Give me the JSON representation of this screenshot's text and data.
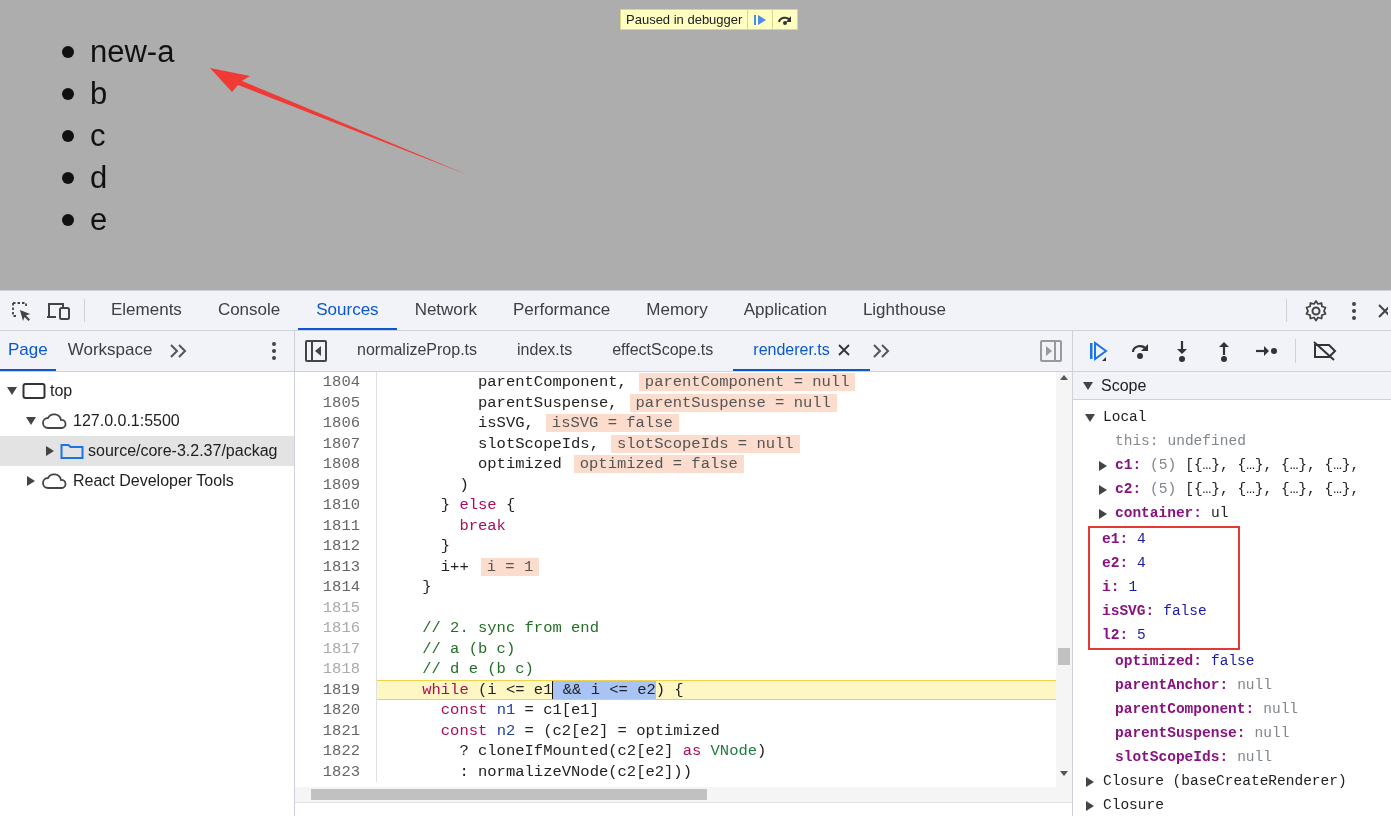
{
  "page": {
    "items": [
      "new-a",
      "b",
      "c",
      "d",
      "e"
    ],
    "paused_banner": {
      "text": "Paused in debugger"
    }
  },
  "devtools": {
    "tabs": [
      {
        "label": "Elements",
        "selected": false
      },
      {
        "label": "Console",
        "selected": false
      },
      {
        "label": "Sources",
        "selected": true
      },
      {
        "label": "Network",
        "selected": false
      },
      {
        "label": "Performance",
        "selected": false
      },
      {
        "label": "Memory",
        "selected": false
      },
      {
        "label": "Application",
        "selected": false
      },
      {
        "label": "Lighthouse",
        "selected": false
      }
    ],
    "navigator": {
      "tabs": [
        {
          "label": "Page",
          "selected": true
        },
        {
          "label": "Workspace",
          "selected": false
        }
      ],
      "tree": [
        {
          "label": "top",
          "kind": "frame",
          "expanded": true,
          "selected": false,
          "children": [
            {
              "label": "127.0.0.1:5500",
              "kind": "cloud",
              "expanded": true,
              "selected": false,
              "children": [
                {
                  "label": "source/core-3.2.37/packag",
                  "kind": "folder",
                  "expanded": false,
                  "selected": true
                }
              ]
            },
            {
              "label": "React Developer Tools",
              "kind": "cloud",
              "expanded": false,
              "selected": false
            }
          ]
        }
      ]
    },
    "editor": {
      "tabs": [
        {
          "label": "normalizeProp.ts",
          "selected": false
        },
        {
          "label": "index.ts",
          "selected": false
        },
        {
          "label": "effectScope.ts",
          "selected": false
        },
        {
          "label": "renderer.ts",
          "selected": true
        }
      ],
      "lines": [
        {
          "number": "1804",
          "muted": false,
          "execution": false,
          "tokens": [
            {
              "text": "          parentComponent,",
              "kind": "plain"
            },
            {
              "text": "parentComponent = null",
              "kind": "value"
            }
          ]
        },
        {
          "number": "1805",
          "muted": false,
          "execution": false,
          "tokens": [
            {
              "text": "          parentSuspense,",
              "kind": "plain"
            },
            {
              "text": "parentSuspense = null",
              "kind": "value"
            }
          ]
        },
        {
          "number": "1806",
          "muted": false,
          "execution": false,
          "tokens": [
            {
              "text": "          isSVG,",
              "kind": "plain"
            },
            {
              "text": "isSVG = false",
              "kind": "value"
            }
          ]
        },
        {
          "number": "1807",
          "muted": false,
          "execution": false,
          "tokens": [
            {
              "text": "          slotScopeIds,",
              "kind": "plain"
            },
            {
              "text": "slotScopeIds = null",
              "kind": "value"
            }
          ]
        },
        {
          "number": "1808",
          "muted": false,
          "execution": false,
          "tokens": [
            {
              "text": "          optimized",
              "kind": "plain"
            },
            {
              "text": "optimized = false",
              "kind": "value"
            }
          ]
        },
        {
          "number": "1809",
          "muted": false,
          "execution": false,
          "tokens": [
            {
              "text": "        )",
              "kind": "plain"
            }
          ]
        },
        {
          "number": "1810",
          "muted": false,
          "execution": false,
          "tokens": [
            {
              "text": "      }",
              "kind": "plain"
            },
            {
              "text": " else",
              "kind": "keyword"
            },
            {
              "text": " {",
              "kind": "plain"
            }
          ]
        },
        {
          "number": "1811",
          "muted": false,
          "execution": false,
          "tokens": [
            {
              "text": "        break",
              "kind": "keyword"
            }
          ]
        },
        {
          "number": "1812",
          "muted": false,
          "execution": false,
          "tokens": [
            {
              "text": "      }",
              "kind": "plain"
            }
          ]
        },
        {
          "number": "1813",
          "muted": false,
          "execution": false,
          "tokens": [
            {
              "text": "      i++",
              "kind": "plain"
            },
            {
              "text": "i = 1",
              "kind": "value"
            }
          ]
        },
        {
          "number": "1814",
          "muted": false,
          "execution": false,
          "tokens": [
            {
              "text": "    }",
              "kind": "plain"
            }
          ]
        },
        {
          "number": "1815",
          "muted": true,
          "execution": false
        },
        {
          "number": "1816",
          "muted": true,
          "execution": false,
          "tokens": [
            {
              "text": "    // 2. sync from end",
              "kind": "comment"
            }
          ]
        },
        {
          "number": "1817",
          "muted": true,
          "execution": false,
          "tokens": [
            {
              "text": "    // a (b c)",
              "kind": "comment"
            }
          ]
        },
        {
          "number": "1818",
          "muted": true,
          "execution": false,
          "tokens": [
            {
              "text": "    // d e (b c)",
              "kind": "comment"
            }
          ]
        },
        {
          "number": "1819",
          "muted": false,
          "execution": true,
          "tokens": [
            {
              "text": "    while",
              "kind": "keyword"
            },
            {
              "text": " (i <= e1",
              "kind": "plain"
            },
            {
              "text": " && i <= e2",
              "kind": "selection"
            },
            {
              "text": ") {",
              "kind": "plain"
            }
          ]
        },
        {
          "number": "1820",
          "muted": false,
          "execution": false,
          "tokens": [
            {
              "text": "      const",
              "kind": "keyword"
            },
            {
              "text": " n1",
              "kind": "def"
            },
            {
              "text": " = c1[e1]",
              "kind": "plain"
            }
          ]
        },
        {
          "number": "1821",
          "muted": false,
          "execution": false,
          "tokens": [
            {
              "text": "      const",
              "kind": "keyword"
            },
            {
              "text": " n2",
              "kind": "def"
            },
            {
              "text": " = (c2[e2] = optimized",
              "kind": "plain"
            }
          ]
        },
        {
          "number": "1822",
          "muted": false,
          "execution": false,
          "tokens": [
            {
              "text": "        ? cloneIfMounted(c2[e2]",
              "kind": "plain"
            },
            {
              "text": " as",
              "kind": "keyword"
            },
            {
              "text": " VNode",
              "kind": "type"
            },
            {
              "text": ")",
              "kind": "plain"
            }
          ]
        },
        {
          "number": "1823",
          "muted": false,
          "execution": false,
          "tokens": [
            {
              "text": "        : normalizeVNode(c2[e2]))",
              "kind": "plain"
            }
          ]
        }
      ]
    },
    "scope": {
      "title": "Scope",
      "expanded": true,
      "sections": [
        {
          "name": "Local",
          "expanded": true,
          "items": [
            {
              "name": "this:",
              "kind": "undefined",
              "own": false,
              "value": "undefined",
              "annotated": false
            },
            {
              "name": "c1:",
              "kind": "object",
              "own": true,
              "count": "(5)",
              "value": "[{…}, {…}, {…}, {…},",
              "annotated": false
            },
            {
              "name": "c2:",
              "kind": "object",
              "own": true,
              "count": "(5)",
              "value": "[{…}, {…}, {…}, {…},",
              "annotated": false
            },
            {
              "name": "container:",
              "kind": "node",
              "own": true,
              "value": "ul",
              "annotated": false
            },
            {
              "name": "e1:",
              "kind": "number",
              "own": true,
              "value": "4",
              "annotated": true
            },
            {
              "name": "e2:",
              "kind": "number",
              "own": true,
              "value": "4",
              "annotated": true
            },
            {
              "name": "i:",
              "kind": "number",
              "own": true,
              "value": "1",
              "annotated": true
            },
            {
              "name": "isSVG:",
              "kind": "boolean",
              "own": true,
              "value": "false",
              "annotated": true
            },
            {
              "name": "l2:",
              "kind": "number",
              "own": true,
              "value": "5",
              "annotated": true
            },
            {
              "name": "optimized:",
              "kind": "boolean",
              "own": true,
              "value": "false",
              "annotated": false
            },
            {
              "name": "parentAnchor:",
              "kind": "null",
              "own": true,
              "value": "null",
              "annotated": false
            },
            {
              "name": "parentComponent:",
              "kind": "null",
              "own": true,
              "value": "null",
              "annotated": false
            },
            {
              "name": "parentSuspense:",
              "kind": "null",
              "own": true,
              "value": "null",
              "annotated": false
            },
            {
              "name": "slotScopeIds:",
              "kind": "null",
              "own": true,
              "value": "null",
              "annotated": false
            }
          ]
        },
        {
          "name": "Closure (baseCreateRenderer)",
          "expanded": false
        },
        {
          "name": "Closure",
          "expanded": false
        }
      ]
    }
  }
}
